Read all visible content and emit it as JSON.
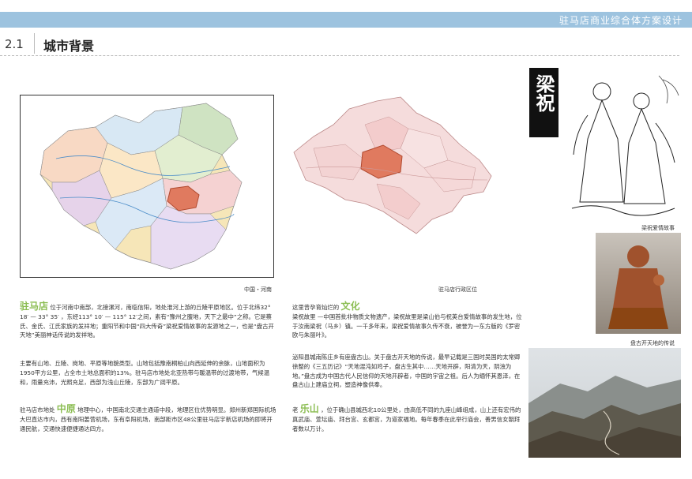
{
  "header": {
    "title": "驻马店商业综合体方案设计"
  },
  "section": {
    "number": "2.1",
    "title": "城市背景"
  },
  "captions": {
    "china_map": "中国・河南",
    "zmd_map": "驻马店行政区位",
    "liangzhu": "梁祝爱情故事",
    "pangu": "盘古开天地的传说"
  },
  "calligraphy": "梁祝",
  "paragraphs": {
    "p1_highlight": "驻马店",
    "p1_text": "位于河南中南部，北接漯河，南临信阳，地处淮河上游的丘陵平原地区。位于北纬32° 18′ — 33° 35′ ，东经113° 10′ — 115° 12′之间，素有“豫州之腹地，天下之最中”之称。它是蔡氏、金氏、江氏家族的发祥地；重阳节和中国“四大传奇”梁祝爱情故事的发源地之一，也是“盘古开天地”美丽神话传说的发祥地。",
    "p2_text": "主要有山地、丘陵、岗地、平原等地貌类型。山地包括豫南桐柏山向西延伸的余脉，山地面积为1950平方公里，占全市土地总面积的13%。驻马店市地处北亚热带与暖温带的过渡地带，气候温和，雨量充沛，光照充足，西部为浅山丘陵，东部为广阔平原。",
    "p3_pre": "驻马店市地处",
    "p3_highlight": "中原",
    "p3_text": "地理中心，中国南北交通主通道中段，地理区位优势明显。郑州新郑国际机场大巴直达市内，西有南阳姜营机场，东有阜阳机场，南部距市区48公里驻马店宇新店机场的即将开通民航，交通快速便捷通达四方。",
    "p4_pre": "这里曾孕育灿烂的",
    "p4_highlight": "文化",
    "p4_text": "梁祝故里 —中国首批非物质文物遗产，梁祝故里是梁山伯与祝英台爱情故事的发生地，位于汝南梁祝（马乡）镇。一千多年来，梁祝爱情故事久传不衰，被誉为一东方版的《罗密欧与朱丽叶》。",
    "p5_text": "泌阳县城南陈庄乡有座盘古山。关于盘古开天地的传说，最早记载是三国时吴国的太常卿徐整的《三五历记》“天地混沌如鸡子，盘古生其中……天地开辟，阳清为天，阴浊为地。”盘古成为中国古代人民信仰的天地开辟者，中国的宇宙之祖。后人为缅怀其恩泽，在盘古山上建庙立祠，塑造神像供奉。",
    "p6_pre": "老",
    "p6_highlight": "乐山",
    "p6_text": "，位于确山县城西北10公里处，由高低不同的九座山峰组成，山上还有宏伟的真武庙、萱坛庙、拜台宫、玄都宫，为道家福地。每年春季在此举行庙会，善男信女朝拜者数以万计。"
  },
  "colors": {
    "header_bar": "#9dc3df",
    "highlight": "#8bbd52",
    "region_fill": "#e07a5f",
    "map_pink": "#f3d6d6"
  }
}
